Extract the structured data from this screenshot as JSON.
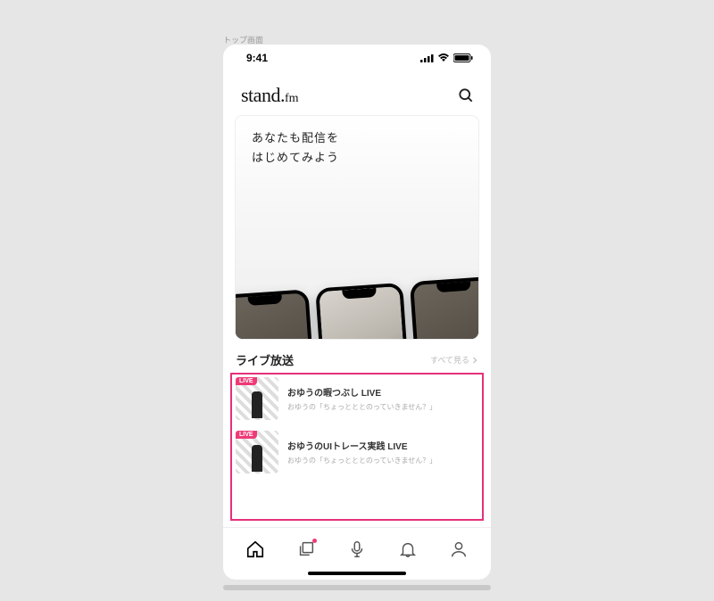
{
  "caption": "トップ画面",
  "statusBar": {
    "time": "9:41"
  },
  "logo": {
    "main": "stand.",
    "sub": "fm"
  },
  "hero": {
    "line1": "あなたも配信を",
    "line2": "はじめてみよう"
  },
  "liveSection": {
    "title": "ライブ放送",
    "moreLabel": "すべて見る",
    "items": [
      {
        "badge": "LIVE",
        "title": "おゆうの暇つぶし LIVE",
        "subtitle": "おゆうの「ちょっとととのっていきません？」"
      },
      {
        "badge": "LIVE",
        "title": "おゆうのUIトレース実践 LIVE",
        "subtitle": "おゆうの「ちょっとととのっていきません？」"
      }
    ]
  },
  "tabs": {
    "home": "home",
    "feed": "feed",
    "record": "record",
    "notifications": "notifications",
    "profile": "profile"
  },
  "colors": {
    "accent": "#e6317a",
    "liveBadge": "#ef3a77"
  }
}
